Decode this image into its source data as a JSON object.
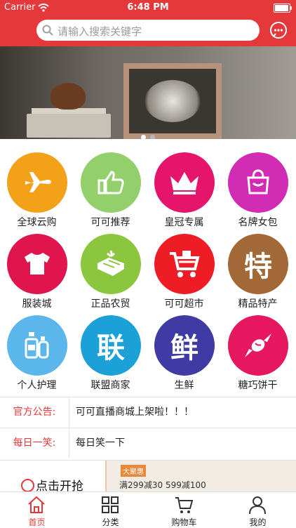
{
  "status_bar": {
    "carrier": "Carrier",
    "time": "6:48 PM"
  },
  "header": {
    "search_placeholder": "请输入搜索关键字"
  },
  "banner": {
    "slides": 2,
    "active_index": 0
  },
  "categories": [
    {
      "label": "全球云购",
      "color": "#f4a11a",
      "icon": "airplane-icon"
    },
    {
      "label": "可可推荐",
      "color": "#93cf6a",
      "icon": "thumbs-up-icon"
    },
    {
      "label": "皇冠专属",
      "color": "#e6156c",
      "icon": "crown-icon"
    },
    {
      "label": "名牌女包",
      "color": "#d22bb4",
      "icon": "handbag-icon"
    },
    {
      "label": "服装城",
      "color": "#e0154e",
      "icon": "tshirt-icon"
    },
    {
      "label": "正品农贸",
      "color": "#8cc63e",
      "icon": "farm-crate-icon"
    },
    {
      "label": "可可超市",
      "color": "#ee1c25",
      "icon": "shopping-cart-icon"
    },
    {
      "label": "精品特产",
      "color": "#a26838",
      "icon": "specialty-char-icon",
      "glyph": "特"
    },
    {
      "label": "个人护理",
      "color": "#5bb7eb",
      "icon": "lotion-bottle-icon"
    },
    {
      "label": "联盟商家",
      "color": "#1ba1d8",
      "icon": "alliance-char-icon",
      "glyph": "联"
    },
    {
      "label": "生鲜",
      "color": "#3f3aa4",
      "icon": "fresh-char-icon",
      "glyph": "鲜"
    },
    {
      "label": "糖巧饼干",
      "color": "#e6175f",
      "icon": "candy-icon"
    }
  ],
  "notices": [
    {
      "tag": "官方公告:",
      "text": "可可直播商城上架啦！！！"
    },
    {
      "tag": "每日一笑:",
      "text": "每日笑一下"
    }
  ],
  "promo": {
    "left_label": "点击开抢",
    "ad_brand": "大聚惠",
    "ad_deal": "满299减30  599减100"
  },
  "tabs": [
    {
      "label": "首页",
      "icon": "home-icon",
      "active": true
    },
    {
      "label": "分类",
      "icon": "grid-icon",
      "active": false
    },
    {
      "label": "购物车",
      "icon": "cart-icon",
      "active": false
    },
    {
      "label": "我的",
      "icon": "user-icon",
      "active": false
    }
  ],
  "colors": {
    "accent": "#e5383b"
  }
}
